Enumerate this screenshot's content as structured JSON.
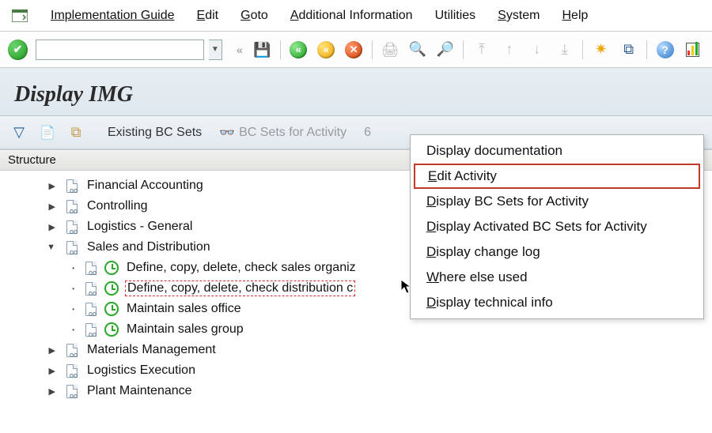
{
  "menu": {
    "implementation_guide": "Implementation Guide",
    "edit": "Edit",
    "goto": "Goto",
    "additional_info": "Additional Information",
    "utilities": "Utilities",
    "system": "System",
    "help": "Help"
  },
  "title": "Display IMG",
  "img_toolbar": {
    "existing_bc_sets": "Existing BC Sets",
    "bc_sets_activity": "BC Sets for Activity",
    "activated_prefix": "6"
  },
  "structure_label": "Structure",
  "tree": {
    "financial_accounting": "Financial Accounting",
    "controlling": "Controlling",
    "logistics_general": "Logistics - General",
    "sales_distribution": "Sales and Distribution",
    "define_sales_org": "Define, copy, delete, check sales organiz",
    "define_distribution": "Define, copy, delete, check distribution c",
    "maintain_sales_office": "Maintain sales office",
    "maintain_sales_group": "Maintain sales group",
    "materials_management": "Materials Management",
    "logistics_execution": "Logistics Execution",
    "plant_maintenance": "Plant Maintenance"
  },
  "ctx": {
    "display_doc": "Display documentation",
    "edit_activity": "Edit Activity",
    "display_bc_sets": "Display BC Sets for Activity",
    "display_activated": "Display Activated BC Sets for Activity",
    "display_change_log": "Display change log",
    "where_else": "Where else used",
    "display_tech": "Display technical info"
  }
}
